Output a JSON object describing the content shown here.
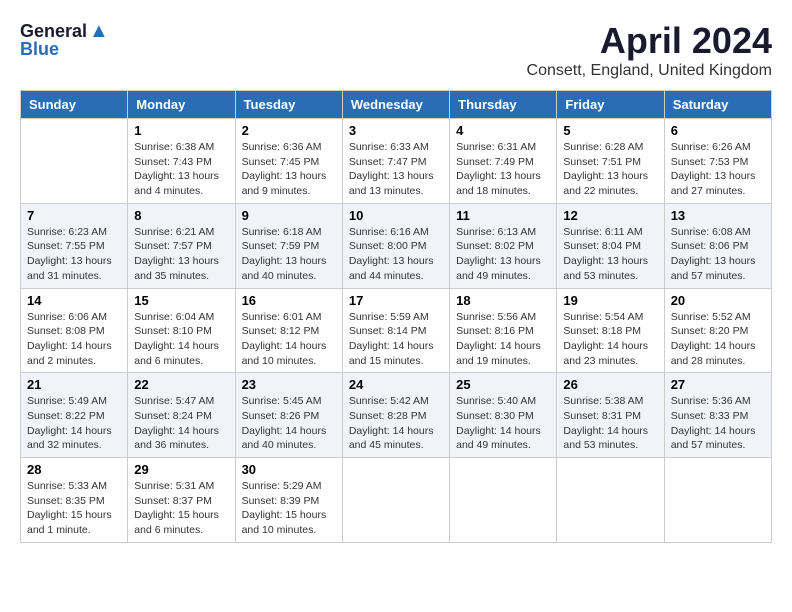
{
  "header": {
    "logo_general": "General",
    "logo_blue": "Blue",
    "month_title": "April 2024",
    "location": "Consett, England, United Kingdom"
  },
  "days_of_week": [
    "Sunday",
    "Monday",
    "Tuesday",
    "Wednesday",
    "Thursday",
    "Friday",
    "Saturday"
  ],
  "weeks": [
    [
      {
        "day": "",
        "info": ""
      },
      {
        "day": "1",
        "info": "Sunrise: 6:38 AM\nSunset: 7:43 PM\nDaylight: 13 hours\nand 4 minutes."
      },
      {
        "day": "2",
        "info": "Sunrise: 6:36 AM\nSunset: 7:45 PM\nDaylight: 13 hours\nand 9 minutes."
      },
      {
        "day": "3",
        "info": "Sunrise: 6:33 AM\nSunset: 7:47 PM\nDaylight: 13 hours\nand 13 minutes."
      },
      {
        "day": "4",
        "info": "Sunrise: 6:31 AM\nSunset: 7:49 PM\nDaylight: 13 hours\nand 18 minutes."
      },
      {
        "day": "5",
        "info": "Sunrise: 6:28 AM\nSunset: 7:51 PM\nDaylight: 13 hours\nand 22 minutes."
      },
      {
        "day": "6",
        "info": "Sunrise: 6:26 AM\nSunset: 7:53 PM\nDaylight: 13 hours\nand 27 minutes."
      }
    ],
    [
      {
        "day": "7",
        "info": "Sunrise: 6:23 AM\nSunset: 7:55 PM\nDaylight: 13 hours\nand 31 minutes."
      },
      {
        "day": "8",
        "info": "Sunrise: 6:21 AM\nSunset: 7:57 PM\nDaylight: 13 hours\nand 35 minutes."
      },
      {
        "day": "9",
        "info": "Sunrise: 6:18 AM\nSunset: 7:59 PM\nDaylight: 13 hours\nand 40 minutes."
      },
      {
        "day": "10",
        "info": "Sunrise: 6:16 AM\nSunset: 8:00 PM\nDaylight: 13 hours\nand 44 minutes."
      },
      {
        "day": "11",
        "info": "Sunrise: 6:13 AM\nSunset: 8:02 PM\nDaylight: 13 hours\nand 49 minutes."
      },
      {
        "day": "12",
        "info": "Sunrise: 6:11 AM\nSunset: 8:04 PM\nDaylight: 13 hours\nand 53 minutes."
      },
      {
        "day": "13",
        "info": "Sunrise: 6:08 AM\nSunset: 8:06 PM\nDaylight: 13 hours\nand 57 minutes."
      }
    ],
    [
      {
        "day": "14",
        "info": "Sunrise: 6:06 AM\nSunset: 8:08 PM\nDaylight: 14 hours\nand 2 minutes."
      },
      {
        "day": "15",
        "info": "Sunrise: 6:04 AM\nSunset: 8:10 PM\nDaylight: 14 hours\nand 6 minutes."
      },
      {
        "day": "16",
        "info": "Sunrise: 6:01 AM\nSunset: 8:12 PM\nDaylight: 14 hours\nand 10 minutes."
      },
      {
        "day": "17",
        "info": "Sunrise: 5:59 AM\nSunset: 8:14 PM\nDaylight: 14 hours\nand 15 minutes."
      },
      {
        "day": "18",
        "info": "Sunrise: 5:56 AM\nSunset: 8:16 PM\nDaylight: 14 hours\nand 19 minutes."
      },
      {
        "day": "19",
        "info": "Sunrise: 5:54 AM\nSunset: 8:18 PM\nDaylight: 14 hours\nand 23 minutes."
      },
      {
        "day": "20",
        "info": "Sunrise: 5:52 AM\nSunset: 8:20 PM\nDaylight: 14 hours\nand 28 minutes."
      }
    ],
    [
      {
        "day": "21",
        "info": "Sunrise: 5:49 AM\nSunset: 8:22 PM\nDaylight: 14 hours\nand 32 minutes."
      },
      {
        "day": "22",
        "info": "Sunrise: 5:47 AM\nSunset: 8:24 PM\nDaylight: 14 hours\nand 36 minutes."
      },
      {
        "day": "23",
        "info": "Sunrise: 5:45 AM\nSunset: 8:26 PM\nDaylight: 14 hours\nand 40 minutes."
      },
      {
        "day": "24",
        "info": "Sunrise: 5:42 AM\nSunset: 8:28 PM\nDaylight: 14 hours\nand 45 minutes."
      },
      {
        "day": "25",
        "info": "Sunrise: 5:40 AM\nSunset: 8:30 PM\nDaylight: 14 hours\nand 49 minutes."
      },
      {
        "day": "26",
        "info": "Sunrise: 5:38 AM\nSunset: 8:31 PM\nDaylight: 14 hours\nand 53 minutes."
      },
      {
        "day": "27",
        "info": "Sunrise: 5:36 AM\nSunset: 8:33 PM\nDaylight: 14 hours\nand 57 minutes."
      }
    ],
    [
      {
        "day": "28",
        "info": "Sunrise: 5:33 AM\nSunset: 8:35 PM\nDaylight: 15 hours\nand 1 minute."
      },
      {
        "day": "29",
        "info": "Sunrise: 5:31 AM\nSunset: 8:37 PM\nDaylight: 15 hours\nand 6 minutes."
      },
      {
        "day": "30",
        "info": "Sunrise: 5:29 AM\nSunset: 8:39 PM\nDaylight: 15 hours\nand 10 minutes."
      },
      {
        "day": "",
        "info": ""
      },
      {
        "day": "",
        "info": ""
      },
      {
        "day": "",
        "info": ""
      },
      {
        "day": "",
        "info": ""
      }
    ]
  ]
}
